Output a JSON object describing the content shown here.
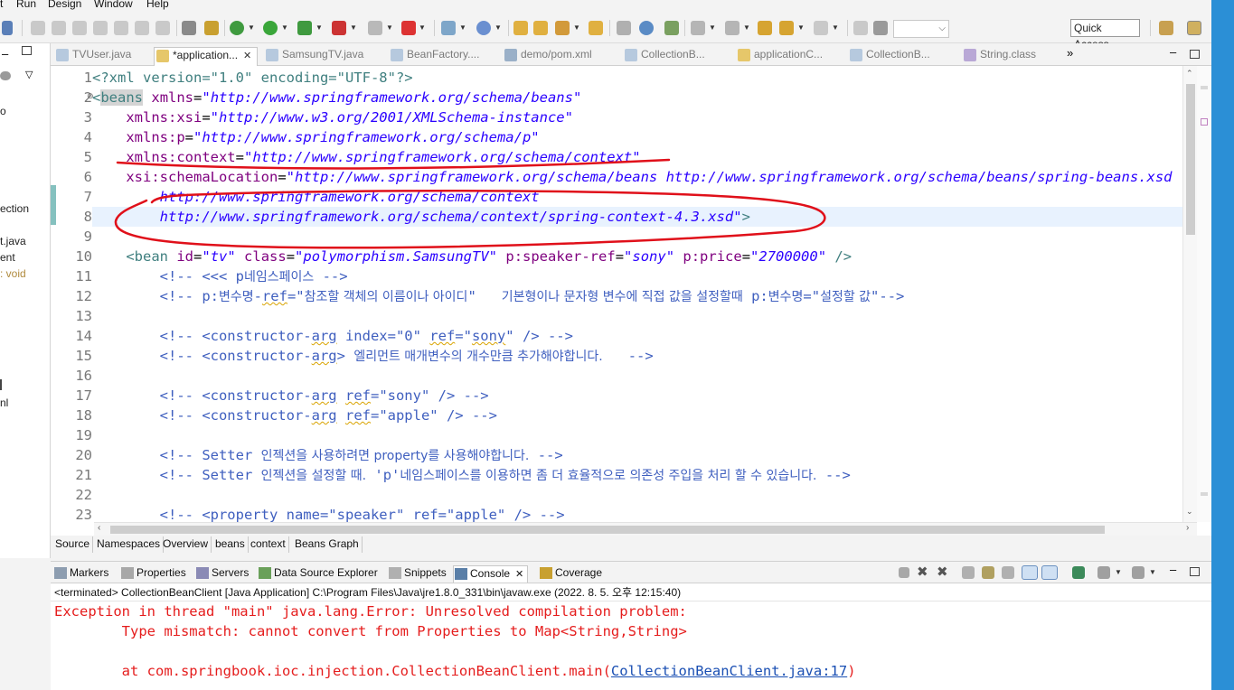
{
  "menu": [
    "t",
    "Run",
    "Design",
    "Window",
    "Help"
  ],
  "toolbar": {
    "quick_access": "Quick Access"
  },
  "left_panel": {
    "lines": [
      "o",
      "ection",
      "t.java",
      "ent",
      ": void",
      "nl"
    ]
  },
  "editor_tabs": [
    {
      "label": "TVUser.java",
      "active": false
    },
    {
      "label": "*application...",
      "active": true
    },
    {
      "label": "SamsungTV.java",
      "active": false
    },
    {
      "label": "BeanFactory....",
      "active": false
    },
    {
      "label": "demo/pom.xml",
      "active": false
    },
    {
      "label": "CollectionB...",
      "active": false
    },
    {
      "label": "applicationC...",
      "active": false
    },
    {
      "label": "CollectionB...",
      "active": false
    },
    {
      "label": "String.class",
      "active": false
    }
  ],
  "overflow_tabs": "»",
  "line_numbers": [
    "1",
    "2",
    "3",
    "4",
    "5",
    "6",
    "7",
    "8",
    "9",
    "10",
    "11",
    "12",
    "13",
    "14",
    "15",
    "16",
    "17",
    "18",
    "19",
    "20",
    "21",
    "22",
    "23"
  ],
  "code": {
    "l1": "<?xml version=\"1.0\" encoding=\"UTF-8\"?>",
    "l2_tag": "beans",
    "l2_attr": "xmlns",
    "l2_val": "\"http://www.springframework.org/schema/beans\"",
    "l3_attr": "xmlns:xsi",
    "l3_val": "\"http://www.w3.org/2001/XMLSchema-instance\"",
    "l4_attr": "xmlns:p",
    "l4_val": "\"http://www.springframework.org/schema/p\"",
    "l5_attr": "xmlns:context",
    "l5_val": "\"http://www.springframework.org/schema/context\"",
    "l6_attr": "xsi:schemaLocation",
    "l6_val": "\"http://www.springframework.org/schema/beans http://www.springframework.org/schema/beans/spring-beans.xsd",
    "l7_val": "http://www.springframework.org/schema/context",
    "l8_val": "http://www.springframework.org/schema/context/spring-context-4.3.xsd\"",
    "l10_tag": "bean",
    "l10_id_attr": "id",
    "l10_id_val": "\"tv\"",
    "l10_class_attr": "class",
    "l10_class_val": "\"polymorphism.SamsungTV\"",
    "l10_sp_attr": "p:speaker-ref",
    "l10_sp_val": "\"sony\"",
    "l10_pr_attr": "p:price",
    "l10_pr_val": "\"2700000\"",
    "l11_a": "<!-- <<< p",
    "l11_b": "네임스페이스",
    "l11_c": " -->",
    "l12_a": "<!-- p:",
    "l12_b": "변수명",
    "l12_c": "-",
    "l12_ref": "ref",
    "l12_d": "=\"",
    "l12_e": "참조할 객체의 이름이나 아이디",
    "l12_f": "\"   ",
    "l12_g": "기본형이나 문자형 변수에 직접 값을 설정할때",
    "l12_h": " p:",
    "l12_i": "변수명",
    "l12_j": "=\"",
    "l12_k": "설정할 값",
    "l12_l": "\"-->",
    "l14_a": "<!-- <constructor-",
    "l14_arg": "arg",
    "l14_b": " index=\"0\" ",
    "l14_ref": "ref",
    "l14_c": "=\"",
    "l14_sony": "sony",
    "l14_d": "\" /> -->",
    "l15_a": "<!-- <constructor-",
    "l15_arg": "arg",
    "l15_b": "> ",
    "l15_c": "엘리먼트 매개변수의 개수만큼 추가해야합니다.",
    "l15_d": "   -->",
    "l17_a": "<!-- <constructor-",
    "l17_arg": "arg",
    "l17_b": " ",
    "l17_ref": "ref",
    "l17_c": "=\"sony\" /> -->",
    "l18_a": "<!-- <constructor-",
    "l18_arg": "arg",
    "l18_b": " ",
    "l18_ref": "ref",
    "l18_c": "=\"apple\" /> -->",
    "l20_a": "<!-- Setter ",
    "l20_b": "인젝션을 사용하려면",
    "l20_c": " property",
    "l20_d": "를 사용해야합니다.",
    "l20_e": " -->",
    "l21_a": "<!-- Setter ",
    "l21_b": "인젝션을 설정할 때.",
    "l21_c": " 'p'",
    "l21_d": "네임스페이스를 이용하면 좀 더 효율적으로 의존성 주입을 처리 할 수 있습니다.",
    "l21_e": " -->",
    "l23": "<!-- <property name=\"speaker\" ref=\"apple\" /> -->"
  },
  "xml_tabs": [
    "Source",
    "Namespaces",
    "Overview",
    "beans",
    "context",
    "Beans Graph"
  ],
  "console_tabs": [
    {
      "label": "Markers"
    },
    {
      "label": "Properties"
    },
    {
      "label": "Servers"
    },
    {
      "label": "Data Source Explorer"
    },
    {
      "label": "Snippets"
    },
    {
      "label": "Console",
      "active": true
    },
    {
      "label": "Coverage"
    }
  ],
  "console": {
    "status": "<terminated> CollectionBeanClient [Java Application] C:\\Program Files\\Java\\jre1.8.0_331\\bin\\javaw.exe (2022. 8. 5. 오후 12:15:40)",
    "line1": "Exception in thread \"main\" java.lang.Error: Unresolved compilation problem: ",
    "line2": "\tType mismatch: cannot convert from Properties to Map<String,String>",
    "line3_pre": "\tat com.springbook.ioc.injection.CollectionBeanClient.main(",
    "line3_link": "CollectionBeanClient.java:17",
    "line3_post": ")"
  },
  "colors": {
    "tag": "#3f7f7f",
    "attr": "#7f007f",
    "value": "#2a00ff",
    "comment": "#3f5fbf",
    "error": "#e51d1d",
    "annotation": "#e0101a",
    "accent_strip": "#2b8fd6"
  }
}
